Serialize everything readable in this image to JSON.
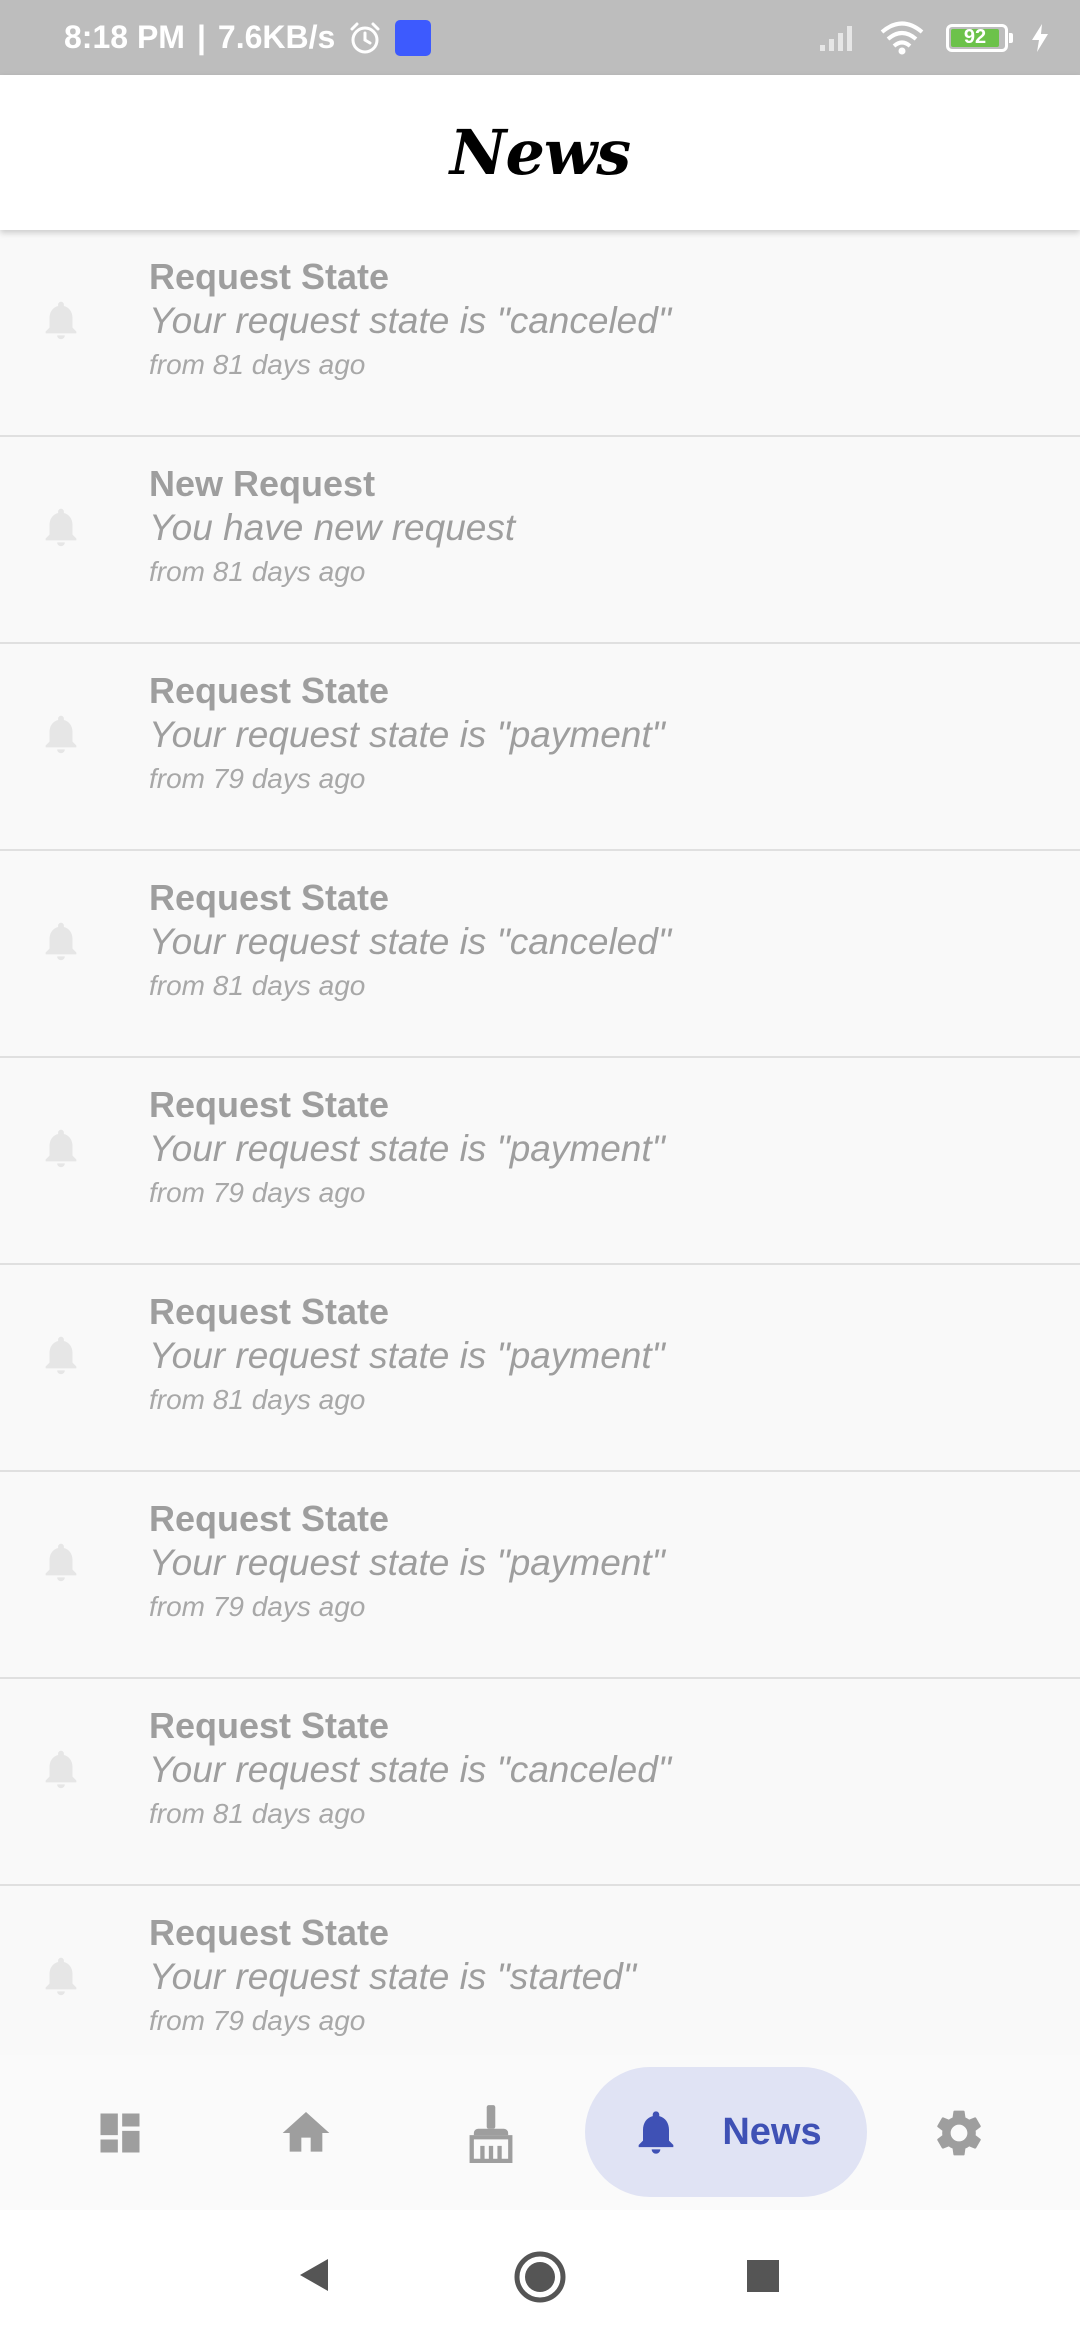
{
  "status_bar": {
    "time": "8:18 PM",
    "separator": "|",
    "speed": "7.6KB/s",
    "battery": "92"
  },
  "header": {
    "title": "News"
  },
  "news": [
    {
      "title": "Request State",
      "message": "Your request state is \"canceled\"",
      "time": "from 81 days ago"
    },
    {
      "title": "New Request",
      "message": "You have new request",
      "time": "from 81 days ago"
    },
    {
      "title": "Request State",
      "message": "Your request state is \"payment\"",
      "time": "from 79 days ago"
    },
    {
      "title": "Request State",
      "message": "Your request state is \"canceled\"",
      "time": "from 81 days ago"
    },
    {
      "title": "Request State",
      "message": "Your request state is \"payment\"",
      "time": "from 79 days ago"
    },
    {
      "title": "Request State",
      "message": "Your request state is \"payment\"",
      "time": "from 81 days ago"
    },
    {
      "title": "Request State",
      "message": "Your request state is \"payment\"",
      "time": "from 79 days ago"
    },
    {
      "title": "Request State",
      "message": "Your request state is \"canceled\"",
      "time": "from 81 days ago"
    },
    {
      "title": "Request State",
      "message": "Your request state is \"started\"",
      "time": "from 79 days ago"
    }
  ],
  "bottom_nav": {
    "items": [
      {
        "icon": "dashboard-icon"
      },
      {
        "icon": "home-icon"
      },
      {
        "icon": "broom-icon"
      },
      {
        "icon": "bell-icon",
        "label": "News",
        "active": true
      },
      {
        "icon": "gear-icon"
      }
    ]
  },
  "colors": {
    "accent": "#3f51b5",
    "active_pill": "#e0e3f4",
    "muted_text": "#9e9e9e",
    "status_bar": "#bdbdbd"
  }
}
